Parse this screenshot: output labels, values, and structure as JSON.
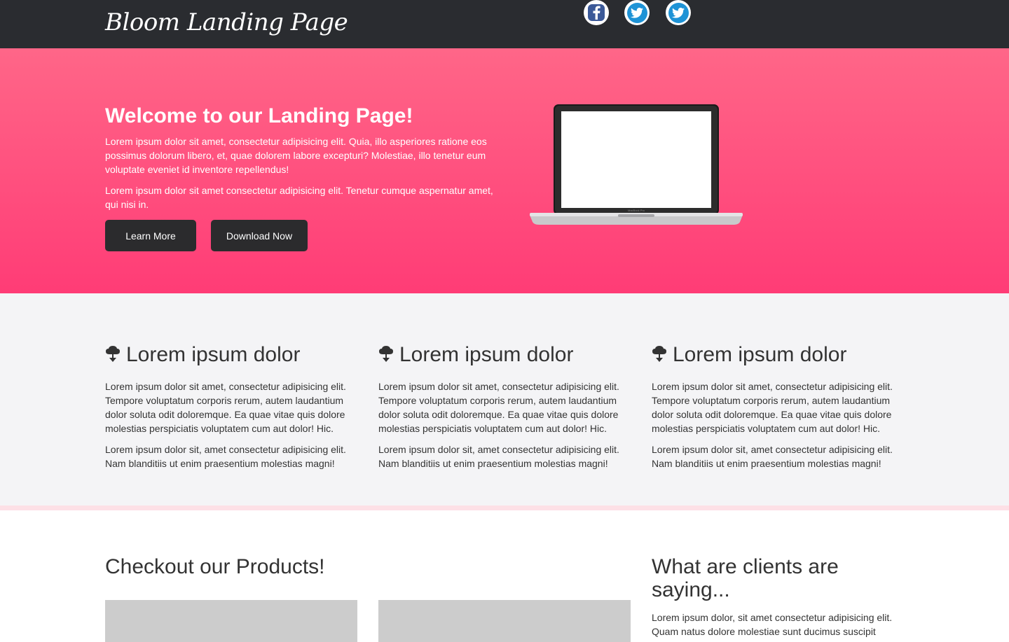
{
  "header": {
    "brand": "Bloom Landing Page",
    "social": [
      {
        "icon": "facebook-icon"
      },
      {
        "icon": "twitter-icon"
      },
      {
        "icon": "twitter-icon"
      }
    ]
  },
  "hero": {
    "title": "Welcome to our Landing Page!",
    "paragraph1": "Lorem ipsum dolor sit amet, consectetur adipisicing elit. Quia, illo asperiores ratione eos possimus dolorum libero, et, quae dolorem labore excepturi? Molestiae, illo tenetur eum voluptate eveniet id inventore repellendus!",
    "paragraph2": "Lorem ipsum dolor sit amet consectetur adipisicing elit. Tenetur cumque aspernatur amet, qui nisi in.",
    "learn_more_label": "Learn More",
    "download_label": "Download Now",
    "laptop_caption": "MacBook Pro"
  },
  "features": [
    {
      "icon": "cloud-download-icon",
      "title": "Lorem ipsum dolor",
      "text1": "Lorem ipsum dolor sit amet, consectetur adipisicing elit. Tempore voluptatum corporis rerum, autem laudantium dolor soluta odit doloremque. Ea quae vitae quis dolore molestias perspiciatis voluptatem cum aut dolor! Hic.",
      "text2": "Lorem ipsum dolor sit, amet consectetur adipisicing elit. Nam blanditiis ut enim praesentium molestias magni!"
    },
    {
      "icon": "cloud-download-icon",
      "title": "Lorem ipsum dolor",
      "text1": "Lorem ipsum dolor sit amet, consectetur adipisicing elit. Tempore voluptatum corporis rerum, autem laudantium dolor soluta odit doloremque. Ea quae vitae quis dolore molestias perspiciatis voluptatem cum aut dolor! Hic.",
      "text2": "Lorem ipsum dolor sit, amet consectetur adipisicing elit. Nam blanditiis ut enim praesentium molestias magni!"
    },
    {
      "icon": "cloud-download-icon",
      "title": "Lorem ipsum dolor",
      "text1": "Lorem ipsum dolor sit amet, consectetur adipisicing elit. Tempore voluptatum corporis rerum, autem laudantium dolor soluta odit doloremque. Ea quae vitae quis dolore molestias perspiciatis voluptatem cum aut dolor! Hic.",
      "text2": "Lorem ipsum dolor sit, amet consectetur adipisicing elit. Nam blanditiis ut enim praesentium molestias magni!"
    }
  ],
  "products": {
    "title": "Checkout our Products!"
  },
  "clients": {
    "title": "What are clients are saying...",
    "quote": "Lorem ipsum dolor, sit amet consectetur adipisicing elit. Quam natus dolore molestiae sunt ducimus suscipit"
  },
  "colors": {
    "topbar": "#2a2c30",
    "hero_top": "#ff6688",
    "hero_bottom": "#ff3c76",
    "button": "#2b2b2d",
    "features_bg": "#f4f4f6",
    "divider": "#fde0e6",
    "facebook": "#3b5998",
    "twitter": "#1e93d6"
  }
}
